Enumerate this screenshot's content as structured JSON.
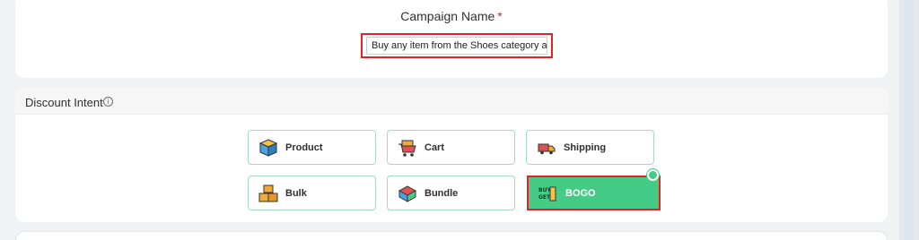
{
  "campaign": {
    "label": "Campaign Name",
    "required_mark": "*",
    "value": "Buy any item from the Shoes category an"
  },
  "intent": {
    "title": "Discount Intent",
    "info_icon": "info-icon",
    "options": [
      {
        "label": "Product",
        "icon": "product-box-icon"
      },
      {
        "label": "Cart",
        "icon": "cart-icon"
      },
      {
        "label": "Shipping",
        "icon": "shipping-truck-icon"
      },
      {
        "label": "Bulk",
        "icon": "bulk-boxes-icon"
      },
      {
        "label": "Bundle",
        "icon": "bundle-icon"
      },
      {
        "label": "BOGO",
        "icon": "buy-get-icon"
      }
    ],
    "selected": "BOGO",
    "accent_color": "#44cc86",
    "highlight_color": "#e02424"
  }
}
